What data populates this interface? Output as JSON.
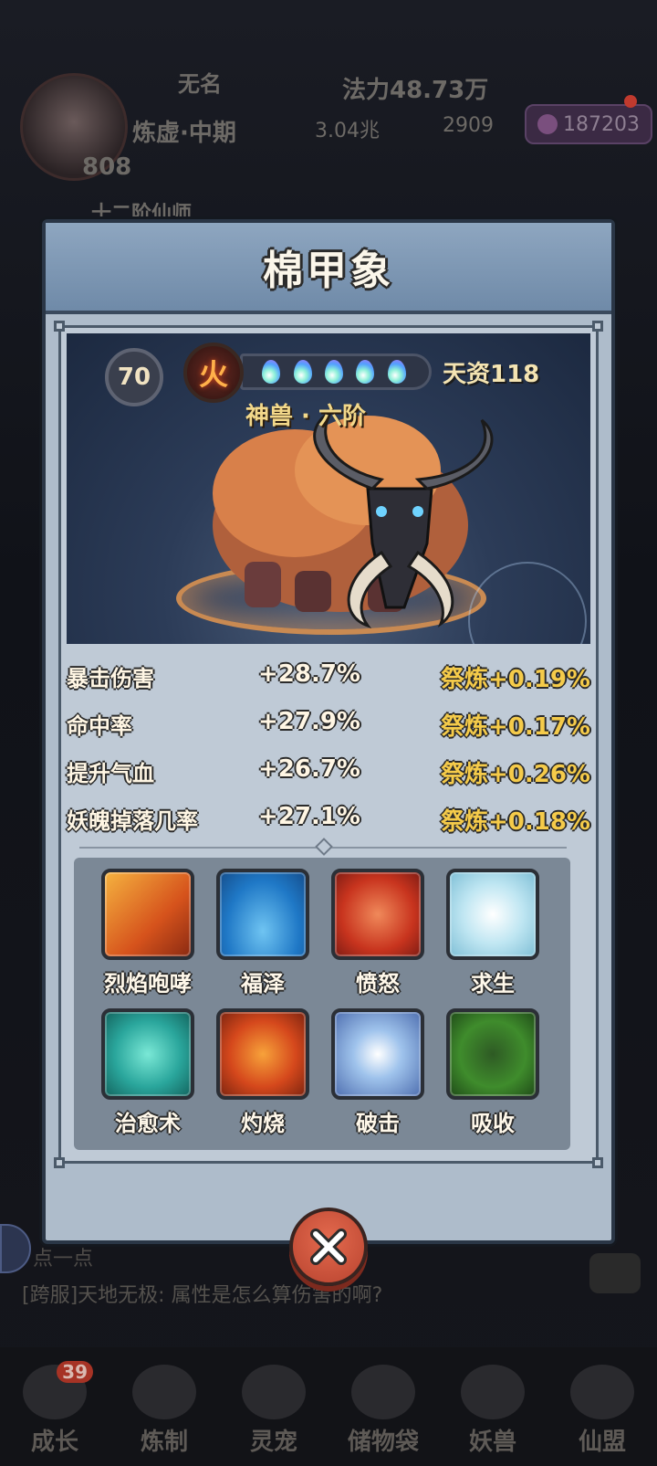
{
  "background": {
    "player_name": "无名",
    "power": "法力48.73万",
    "realm": "炼虚·中期",
    "money": "3.04兆",
    "silver": "2909",
    "gems": "187203",
    "level": "808",
    "title": "十二阶仙师",
    "chat_prev": "点一点",
    "chat_line": "[跨服]天地无极: 属性是怎么算伤害的啊?",
    "nav": [
      {
        "label": "成长",
        "badge": "39"
      },
      {
        "label": "炼制"
      },
      {
        "label": "灵宠"
      },
      {
        "label": "储物袋"
      },
      {
        "label": "妖兽"
      },
      {
        "label": "仙盟"
      }
    ]
  },
  "modal": {
    "title": "棉甲象",
    "level": "70",
    "element": "火",
    "aptitude": "天资118",
    "rank": "神兽 · 六阶",
    "drops": 5,
    "drop_icon": "spirit-drop-icon",
    "stats": [
      {
        "name": "暴击伤害",
        "value": "+28.7%",
        "bonus": "祭炼+0.19%"
      },
      {
        "name": "命中率",
        "value": "+27.9%",
        "bonus": "祭炼+0.17%"
      },
      {
        "name": "提升气血",
        "value": "+26.7%",
        "bonus": "祭炼+0.26%"
      },
      {
        "name": "妖魄掉落几率",
        "value": "+27.1%",
        "bonus": "祭炼+0.18%"
      }
    ],
    "skills": [
      {
        "name": "烈焰咆哮",
        "icon": "flame-roar-icon"
      },
      {
        "name": "福泽",
        "icon": "water-ripple-icon"
      },
      {
        "name": "愤怒",
        "icon": "angry-face-icon"
      },
      {
        "name": "求生",
        "icon": "survival-spirit-icon"
      },
      {
        "name": "治愈术",
        "icon": "healing-drop-icon"
      },
      {
        "name": "灼烧",
        "icon": "burn-icon"
      },
      {
        "name": "破击",
        "icon": "shatter-icon"
      },
      {
        "name": "吸收",
        "icon": "absorb-leaf-icon"
      }
    ],
    "colors": {
      "bonus": "#f5cb4a",
      "panel": "#bfcad6",
      "header": "#7f98b5"
    }
  }
}
